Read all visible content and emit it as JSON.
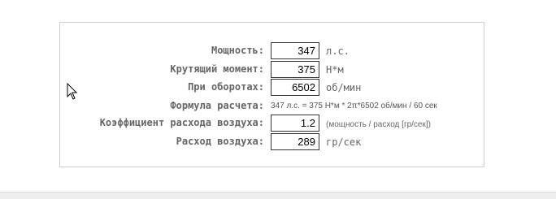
{
  "calculator": {
    "rows": [
      {
        "label": "Мощность:",
        "value": "347",
        "unit": "л.с."
      },
      {
        "label": "Крутящий момент:",
        "value": "375",
        "unit": "Н*м"
      },
      {
        "label": "При оборотах:",
        "value": "6502",
        "unit": "об/мин"
      },
      {
        "label": "Формула расчета:",
        "formula": "347 л.с. = 375 Н*м * 2π*6502 об/мин / 60 сек"
      },
      {
        "label": "Коэффициент расхода воздуха:",
        "value": "1.2",
        "unit": "(мощность / расход [гр/сек])"
      },
      {
        "label": "Расход воздуха:",
        "value": "289",
        "unit": "гр/сек"
      }
    ]
  },
  "icons": {
    "cursor": "mouse-pointer-icon"
  }
}
